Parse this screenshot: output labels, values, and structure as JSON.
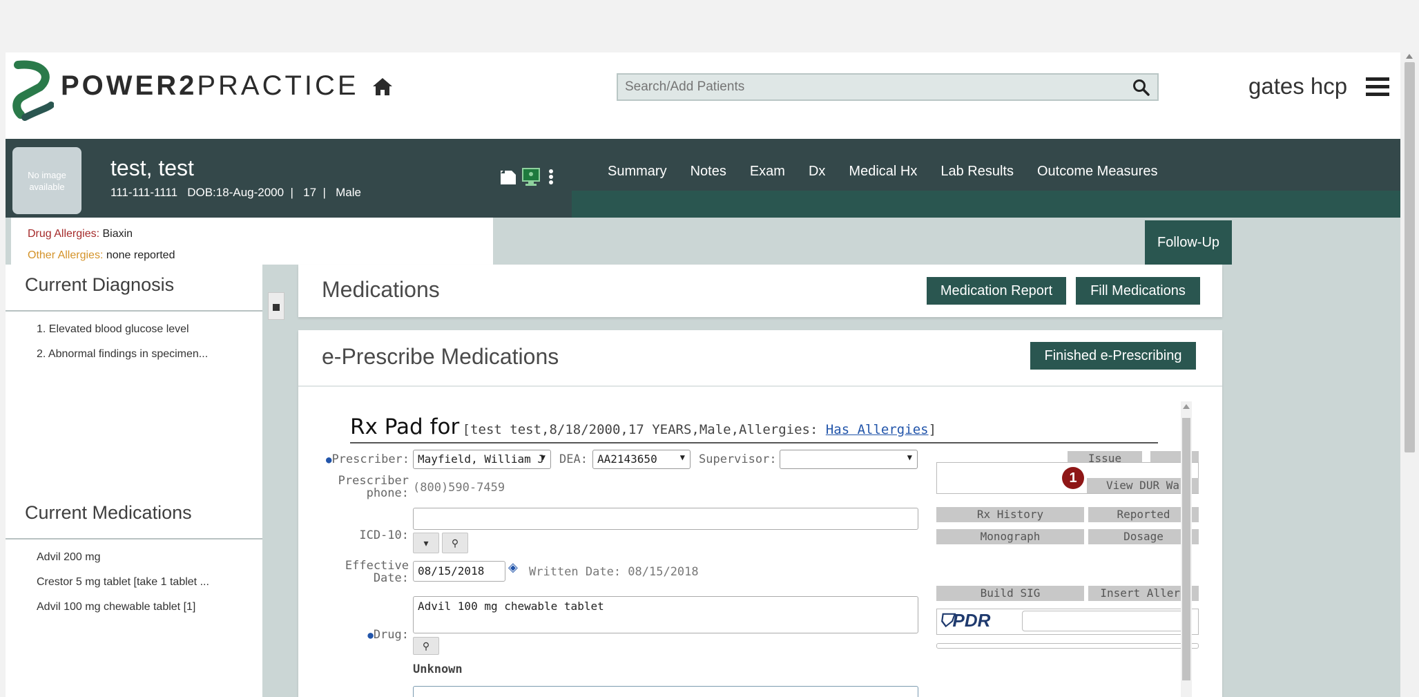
{
  "header": {
    "logo_bold": "POWER2",
    "logo_light": "PRACTICE",
    "search_placeholder": "Search/Add Patients",
    "username": "gates hcp"
  },
  "patient": {
    "avatar_text": "No image available",
    "name": "test, test",
    "id": "111-111-1111",
    "dob": "DOB:18-Aug-2000",
    "age": "17",
    "sex": "Male",
    "drug_allergies_label": "Drug Allergies:",
    "drug_allergies_value": "Biaxin",
    "other_allergies_label": "Other Allergies:",
    "other_allergies_value": "none reported"
  },
  "nav": {
    "tabs": [
      "Summary",
      "Notes",
      "Exam",
      "Dx",
      "Medical Hx",
      "Lab Results",
      "Outcome Measures"
    ]
  },
  "followup_label": "Follow-Up",
  "left_panel": {
    "diagnosis_title": "Current Diagnosis",
    "diagnoses": [
      "1. Elevated blood glucose level",
      "2. Abnormal findings in specimen..."
    ],
    "medications_title": "Current Medications",
    "medications": [
      "Advil 200 mg",
      "Crestor 5 mg tablet [take 1 tablet ...",
      "Advil 100 mg chewable tablet [1]"
    ]
  },
  "medications_card": {
    "title": "Medications",
    "report_label": "Medication Report",
    "fill_label": "Fill Medications"
  },
  "eprescribe_card": {
    "title": "e-Prescribe Medications",
    "finished_label": "Finished e-Prescribing"
  },
  "rx_pad": {
    "title": "Rx Pad for",
    "patient_summary": "[test test,8/18/2000,17 YEARS,Male,Allergies: ",
    "allergies_link": "Has Allergies",
    "summary_close": "]",
    "prescriber_label": "Prescriber:",
    "prescriber_value": "Mayfield, William J",
    "dea_label": "DEA:",
    "dea_value": "AA2143650",
    "supervisor_label": "Supervisor:",
    "supervisor_value": "",
    "prescriber_phone_label_1": "Prescriber",
    "prescriber_phone_label_2": "phone:",
    "prescriber_phone_value": "(800)590-7459",
    "icd10_label": "ICD-10:",
    "icd10_value": "",
    "effective_date_label_1": "Effective",
    "effective_date_label_2": "Date:",
    "effective_date_value": "08/15/2018",
    "written_date": "Written Date: 08/15/2018",
    "drug_label": "Drug:",
    "drug_value": "Advil 100 mg chewable tablet",
    "drug_status": "Unknown",
    "warning_count": "1",
    "side_buttons": {
      "issue": "Issue",
      "view_dur": "View DUR Wa",
      "rx_history": "Rx History",
      "reported": "Reported",
      "monograph": "Monograph",
      "dosage": "Dosage",
      "build_sig": "Build SIG",
      "insert_allergy": "Insert Allerg"
    },
    "pdr_logo": "PDR"
  },
  "colors": {
    "brand_dark": "#2a5650",
    "patient_bar": "#34484a",
    "page_bg": "#cbd6d5",
    "allergy_drug": "#a52a2a",
    "allergy_other": "#d4932a",
    "warning": "#8e1616"
  },
  "icons": [
    "home-icon",
    "search-icon",
    "hamburger-menu-icon",
    "note-icon",
    "monitor-icon",
    "kebab-menu-icon",
    "dropdown-icon",
    "magnifier-icon",
    "calendar-icon",
    "warning-icon"
  ]
}
